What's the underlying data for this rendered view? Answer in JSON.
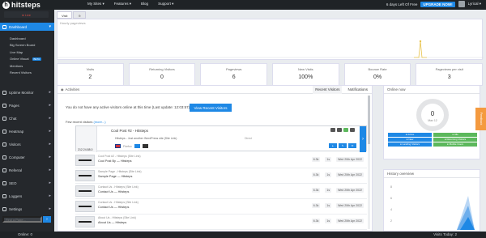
{
  "topbar": {
    "logo_text": "hitsteps",
    "nav": [
      "My Sites ▾",
      "Features ▾",
      "Blog",
      "Support ▾"
    ],
    "trial_text": "6 days Left Of Free",
    "upgrade_label": "UPGRADE NOW!",
    "user_label": "Lyrical ▾"
  },
  "sidebar": {
    "live_label": "● Live",
    "items": [
      {
        "label": "Dashboard",
        "active": true
      },
      {
        "label": "Uptime Monitor"
      },
      {
        "label": "Pages"
      },
      {
        "label": "Chat"
      },
      {
        "label": "Heatmap"
      },
      {
        "label": "Visitors"
      },
      {
        "label": "Computer"
      },
      {
        "label": "Referral"
      },
      {
        "label": "SEO"
      },
      {
        "label": "Loggers"
      },
      {
        "label": "Settings"
      }
    ],
    "subitems": [
      "Dashboard",
      "Big Screen Board",
      "Live Map",
      "Online Visual",
      "Mentions",
      "Recent Visitors"
    ],
    "beta_label": "BETA",
    "find_placeholder": "Find a Page...",
    "find_button": "›"
  },
  "main": {
    "tabs": [
      "Visit",
      "⊕"
    ],
    "chart_caption": "Hourly pageviews",
    "stats": [
      {
        "label": "Visits",
        "value": "2"
      },
      {
        "label": "Returning Visitors",
        "value": "0"
      },
      {
        "label": "Pageviews",
        "value": "6"
      },
      {
        "label": "New Visits",
        "value": "100%"
      },
      {
        "label": "Bounce Rate",
        "value": "0%"
      },
      {
        "label": "Pageviews per visit",
        "value": "3"
      }
    ]
  },
  "activity": {
    "title": "Activities",
    "tabs": [
      "Recent Visitors",
      "Notifications"
    ],
    "notice": "You do not have any active visitors online at this time (Last update: 12:03:57)",
    "view_button": "View Recent Visitors",
    "recent_label": "Few recent visitors",
    "recent_more": "(more...)",
    "card": {
      "title": "Cool Post #2 - Hitsteps",
      "url": "Hitsteps - Just another WordPress site (Site Link)",
      "referrer": "Direct",
      "ip": "212.24.88.0",
      "browser": "Firefox",
      "next": "›"
    },
    "rows": [
      {
        "title": "Cool Post #2 - Hitsteps (Site Link)",
        "sub": "Cool Post By — Hitsteps",
        "views": "6.3k",
        "time": "1s",
        "date": "Wed 20th Apr 2022"
      },
      {
        "title": "Sample Page - Hitsteps (Site Link)",
        "sub": "Sample Page — Hitsteps",
        "views": "6.3k",
        "time": "1s",
        "date": "Wed 20th Apr 2022"
      },
      {
        "title": "Contact Us - Hitsteps (Site Link)",
        "sub": "Contact Us — Hitsteps",
        "views": "6.3k",
        "time": "1s",
        "date": "Wed 20th Apr 2022"
      },
      {
        "title": "Contact Us - Hitsteps (Site Link)",
        "sub": "Contact Us — Hitsteps",
        "views": "6.3k",
        "time": "1s",
        "date": "Wed 20th Apr 2022"
      },
      {
        "title": "About Us - Hitsteps (Site Link)",
        "sub": "About Us — Hitsteps",
        "views": "6.3k",
        "time": "1s",
        "date": "Wed 20th Apr 2022"
      }
    ]
  },
  "online": {
    "title": "Online now",
    "count": "0",
    "sub": "Max 12",
    "legend": [
      "● Active",
      "● Idle",
      "● New",
      "● Returning Visitors",
      "● Landing Visitors",
      "● Mobile Users"
    ],
    "gauge_colors": [
      "#e0e0e0",
      "#cfcfcf"
    ]
  },
  "history": {
    "title": "History overview",
    "y_ticks": [
      "8",
      "6",
      "4",
      "2"
    ]
  },
  "feedback_label": "Feedback",
  "bottombar": {
    "online_label": "Online: 0",
    "visits_today": "Visits Today: 2"
  }
}
